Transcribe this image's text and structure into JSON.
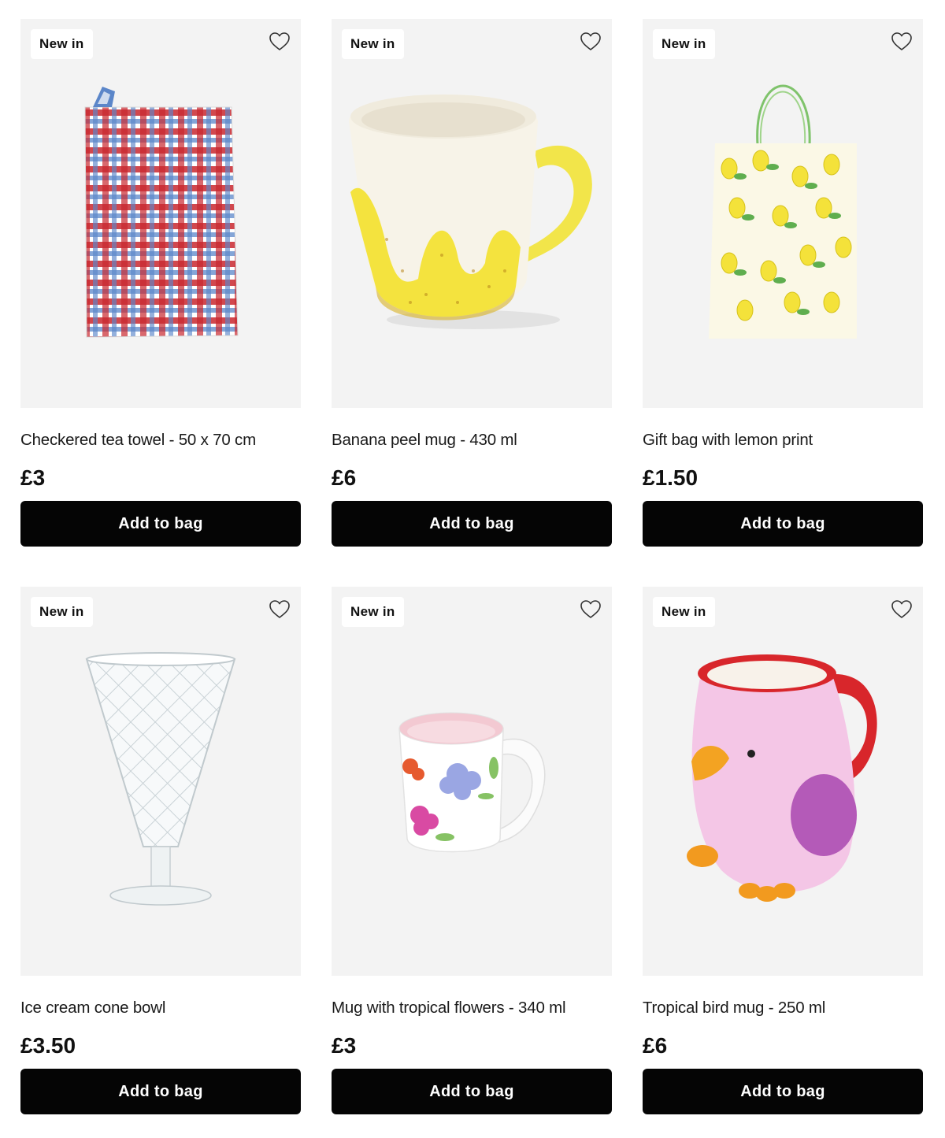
{
  "products": [
    {
      "badge": "New in",
      "image": "checkered-tea-towel",
      "title": "Checkered tea towel - 50 x 70 cm",
      "price": "£3",
      "cta": "Add to bag"
    },
    {
      "badge": "New in",
      "image": "banana-peel-mug",
      "title": "Banana peel mug - 430 ml",
      "price": "£6",
      "cta": "Add to bag"
    },
    {
      "badge": "New in",
      "image": "lemon-print-gift-bag",
      "title": "Gift bag with lemon print",
      "price": "£1.50",
      "cta": "Add to bag"
    },
    {
      "badge": "New in",
      "image": "ice-cream-cone-bowl",
      "title": "Ice cream cone bowl",
      "price": "£3.50",
      "cta": "Add to bag"
    },
    {
      "badge": "New in",
      "image": "tropical-flowers-mug",
      "title": "Mug with tropical flowers - 340 ml",
      "price": "£3",
      "cta": "Add to bag"
    },
    {
      "badge": "New in",
      "image": "tropical-bird-mug",
      "title": "Tropical bird mug - 250 ml",
      "price": "£6",
      "cta": "Add to bag"
    }
  ],
  "icons": {
    "favourite": "heart-outline-icon"
  },
  "colors": {
    "button_bg": "#050505",
    "card_bg": "#f3f3f3"
  }
}
